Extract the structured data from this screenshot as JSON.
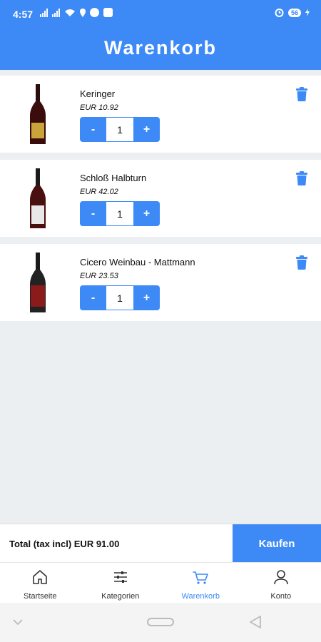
{
  "status_bar": {
    "time": "4:57",
    "battery": "56"
  },
  "header": {
    "title": "Warenkorb"
  },
  "cart": {
    "items": [
      {
        "name": "Keringer",
        "price": "EUR 10.92",
        "quantity": "1",
        "label_color": "#c9a43a"
      },
      {
        "name": "Schloß Halbturn",
        "price": "EUR 42.02",
        "quantity": "1",
        "label_color": "#e8e8e8"
      },
      {
        "name": "Cicero Weinbau - Mattmann",
        "price": "EUR 23.53",
        "quantity": "1",
        "label_color": "#8b1a1a"
      }
    ],
    "minus_label": "-",
    "plus_label": "+"
  },
  "checkout": {
    "total": "Total (tax incl) EUR 91.00",
    "buy_label": "Kaufen"
  },
  "bottom_nav": {
    "items": [
      {
        "label": "Startseite",
        "icon": "home-icon"
      },
      {
        "label": "Kategorien",
        "icon": "sliders-icon"
      },
      {
        "label": "Warenkorb",
        "icon": "cart-icon",
        "active": true
      },
      {
        "label": "Konto",
        "icon": "user-icon"
      }
    ]
  },
  "colors": {
    "primary": "#3d8af7",
    "background": "#eceff1"
  }
}
